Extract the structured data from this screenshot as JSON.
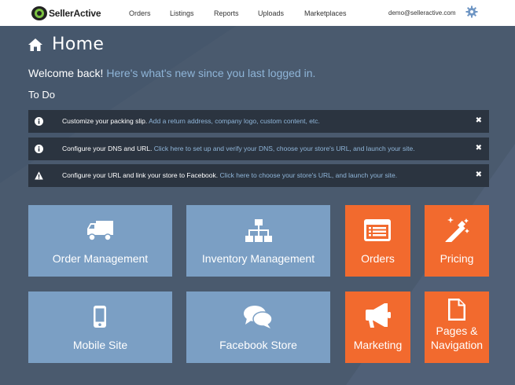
{
  "brand": {
    "name_a": "Seller",
    "name_b": "Active"
  },
  "nav": {
    "items": [
      {
        "label": "Orders"
      },
      {
        "label": "Listings"
      },
      {
        "label": "Reports"
      },
      {
        "label": "Uploads"
      },
      {
        "label": "Marketplaces"
      }
    ],
    "user_email": "demo@selleractive.com"
  },
  "page": {
    "title": "Home",
    "welcome_bold": "Welcome back!",
    "welcome_sub": "Here's what's new since you last logged in.",
    "todo_heading": "To Do"
  },
  "notices": [
    {
      "icon": "info-icon",
      "text": "Customize your packing slip.",
      "link": "Add a return address, company logo, custom content, etc.",
      "close": "✖"
    },
    {
      "icon": "info-icon",
      "text": "Configure your DNS and URL.",
      "link": "Click here to set up and verify your DNS, choose your store's URL, and launch your site.",
      "close": "✖"
    },
    {
      "icon": "warning-icon",
      "text": "Configure your URL and link your store to Facebook.",
      "link": "Click here to choose your store's URL, and launch your site.",
      "close": "✖"
    }
  ],
  "tiles": [
    {
      "label": "Order Management",
      "icon": "truck-icon",
      "color": "#7b9fc4"
    },
    {
      "label": "Inventory Management",
      "icon": "sitemap-icon",
      "color": "#7b9fc4"
    },
    {
      "label": "Orders",
      "icon": "list-window-icon",
      "color": "#f26a2e"
    },
    {
      "label": "Pricing",
      "icon": "magic-wand-icon",
      "color": "#f26a2e"
    },
    {
      "label": "Mobile Site",
      "icon": "mobile-phone-icon",
      "color": "#7b9fc4"
    },
    {
      "label": "Facebook Store",
      "icon": "chat-bubbles-icon",
      "color": "#7b9fc4"
    },
    {
      "label": "Marketing",
      "icon": "megaphone-icon",
      "color": "#f26a2e"
    },
    {
      "label_line1": "Pages &",
      "label_line2": "Navigation",
      "icon": "document-icon",
      "color": "#f26a2e"
    }
  ],
  "colors": {
    "background": "#4a5a6e",
    "tile_blue": "#7b9fc4",
    "tile_orange": "#f26a2e",
    "notice_bg": "#2b3440",
    "link": "#8fb5d8"
  }
}
